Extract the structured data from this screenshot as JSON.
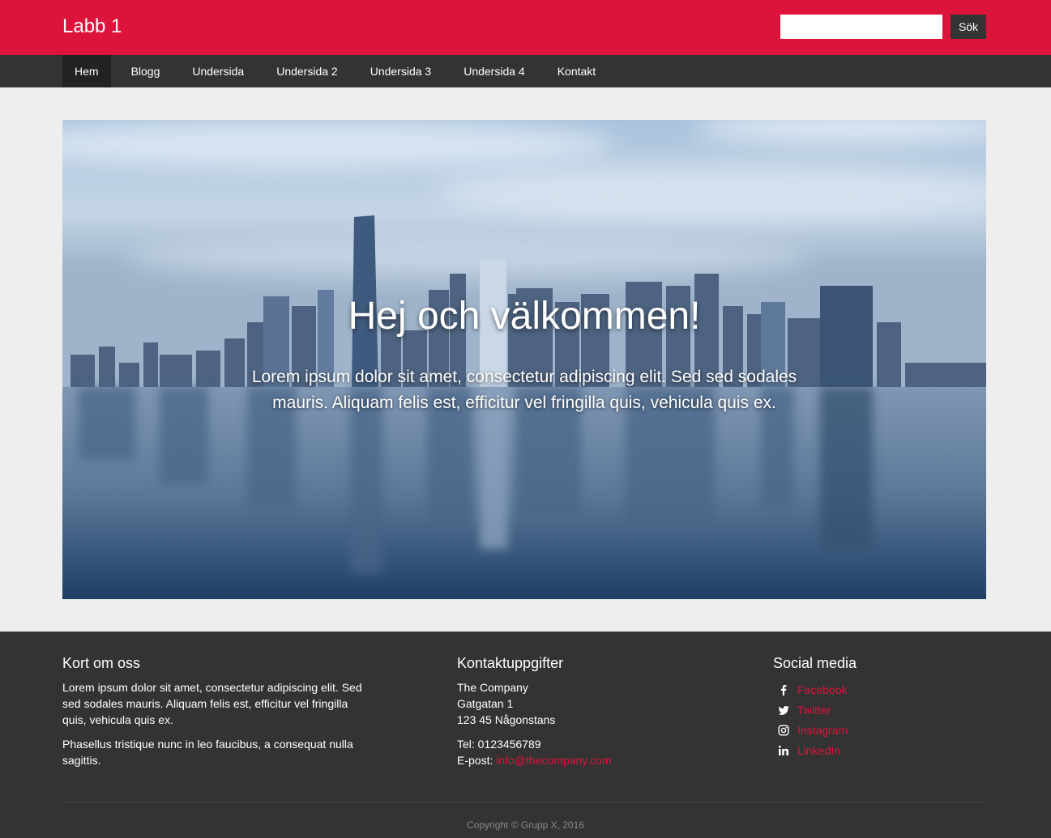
{
  "header": {
    "brand": "Labb 1",
    "search_placeholder": "",
    "search_value": "",
    "search_button": "Sök"
  },
  "nav": {
    "items": [
      {
        "label": "Hem",
        "active": true
      },
      {
        "label": "Blogg"
      },
      {
        "label": "Undersida"
      },
      {
        "label": "Undersida 2"
      },
      {
        "label": "Undersida 3"
      },
      {
        "label": "Undersida 4"
      },
      {
        "label": "Kontakt"
      }
    ]
  },
  "hero": {
    "title": "Hej och välkommen!",
    "text": "Lorem ipsum dolor sit amet, consectetur adipiscing elit. Sed sed sodales mauris. Aliquam felis est, efficitur vel fringilla quis, vehicula quis ex."
  },
  "footer": {
    "about": {
      "heading": "Kort om oss",
      "p1": "Lorem ipsum dolor sit amet, consectetur adipiscing elit. Sed sed sodales mauris. Aliquam felis est, efficitur vel fringilla quis, vehicula quis ex.",
      "p2": "Phasellus tristique nunc in leo faucibus, a consequat nulla sagittis."
    },
    "contact": {
      "heading": "Kontaktuppgifter",
      "company": "The Company",
      "street": "Gatgatan 1",
      "city": "123 45 Någonstans",
      "phone": "Tel: 0123456789",
      "email_label": "E-post:",
      "email": "info@thecompany.com"
    },
    "social": {
      "heading": "Social media",
      "items": [
        {
          "label": "Facebook",
          "icon": "facebook-icon"
        },
        {
          "label": "Twitter",
          "icon": "twitter-icon"
        },
        {
          "label": "Instagram",
          "icon": "instagram-icon"
        },
        {
          "label": "LinkedIn",
          "icon": "linkedin-icon"
        }
      ]
    },
    "copyright": "Copyright © Grupp X, 2016"
  },
  "colors": {
    "brand": "#dc143c",
    "dark": "#333333",
    "page_bg": "#eeeeee"
  }
}
